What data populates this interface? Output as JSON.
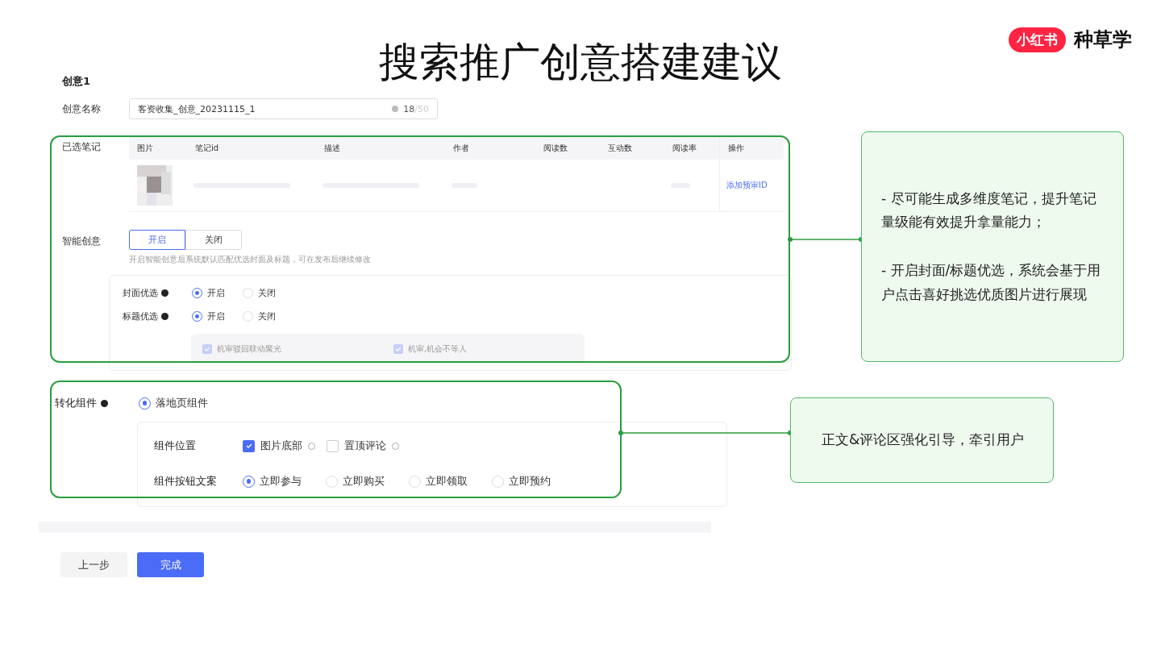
{
  "title": "搜索推广创意搭建建议",
  "logo": {
    "badge": "小红书",
    "text": "种草学"
  },
  "form": {
    "section_title": "创意1",
    "name_field": {
      "label": "创意名称",
      "value": "客资收集_创意_20231115_1",
      "count": "18",
      "max": "/50"
    },
    "notes": {
      "label": "已选笔记",
      "columns": [
        "图片",
        "笔记id",
        "描述",
        "作者",
        "阅读数",
        "互动数",
        "阅读率",
        "操作"
      ],
      "rows": [
        {
          "action": "添加预审ID"
        }
      ]
    },
    "smart": {
      "label": "智能创意",
      "options": [
        {
          "label": "开启",
          "selected": true
        },
        {
          "label": "关闭",
          "selected": false
        }
      ],
      "hint": "开启智能创意后系统默认匹配优选封面及标题，可在发布后继续修改"
    },
    "optimizations": [
      {
        "label": "封面优选",
        "options": [
          {
            "label": "开启",
            "selected": true
          },
          {
            "label": "关闭",
            "selected": false
          }
        ]
      },
      {
        "label": "标题优选",
        "options": [
          {
            "label": "开启",
            "selected": true
          },
          {
            "label": "关闭",
            "selected": false
          }
        ]
      }
    ],
    "review_options": [
      {
        "label": "机审驳回联动聚光",
        "checked": true,
        "disabled": true
      },
      {
        "label": "机审,机会不等人",
        "checked": true,
        "disabled": true
      }
    ],
    "component": {
      "label": "转化组件",
      "options": [
        {
          "label": "落地页组件",
          "selected": true
        }
      ],
      "position": {
        "label": "组件位置",
        "options": [
          {
            "label": "图片底部",
            "checked": true
          },
          {
            "label": "置顶评论",
            "checked": false
          }
        ]
      },
      "button_text": {
        "label": "组件按钮文案",
        "options": [
          {
            "label": "立即参与",
            "selected": true
          },
          {
            "label": "立即购买",
            "selected": false
          },
          {
            "label": "立即领取",
            "selected": false
          },
          {
            "label": "立即预约",
            "selected": false
          }
        ]
      }
    },
    "actions": [
      {
        "label": "上一步",
        "kind": "secondary"
      },
      {
        "label": "完成",
        "kind": "primary"
      }
    ]
  },
  "callouts": [
    {
      "paragraphs": [
        "- 尽可能生成多维度笔记，提升笔记量级能有效提升拿量能力；",
        "- 开启封面/标题优选，系统会基于用户点击喜好挑选优质图片进行展现"
      ]
    },
    {
      "paragraphs": [
        "正文&评论区强化引导，牵引用户"
      ]
    }
  ]
}
